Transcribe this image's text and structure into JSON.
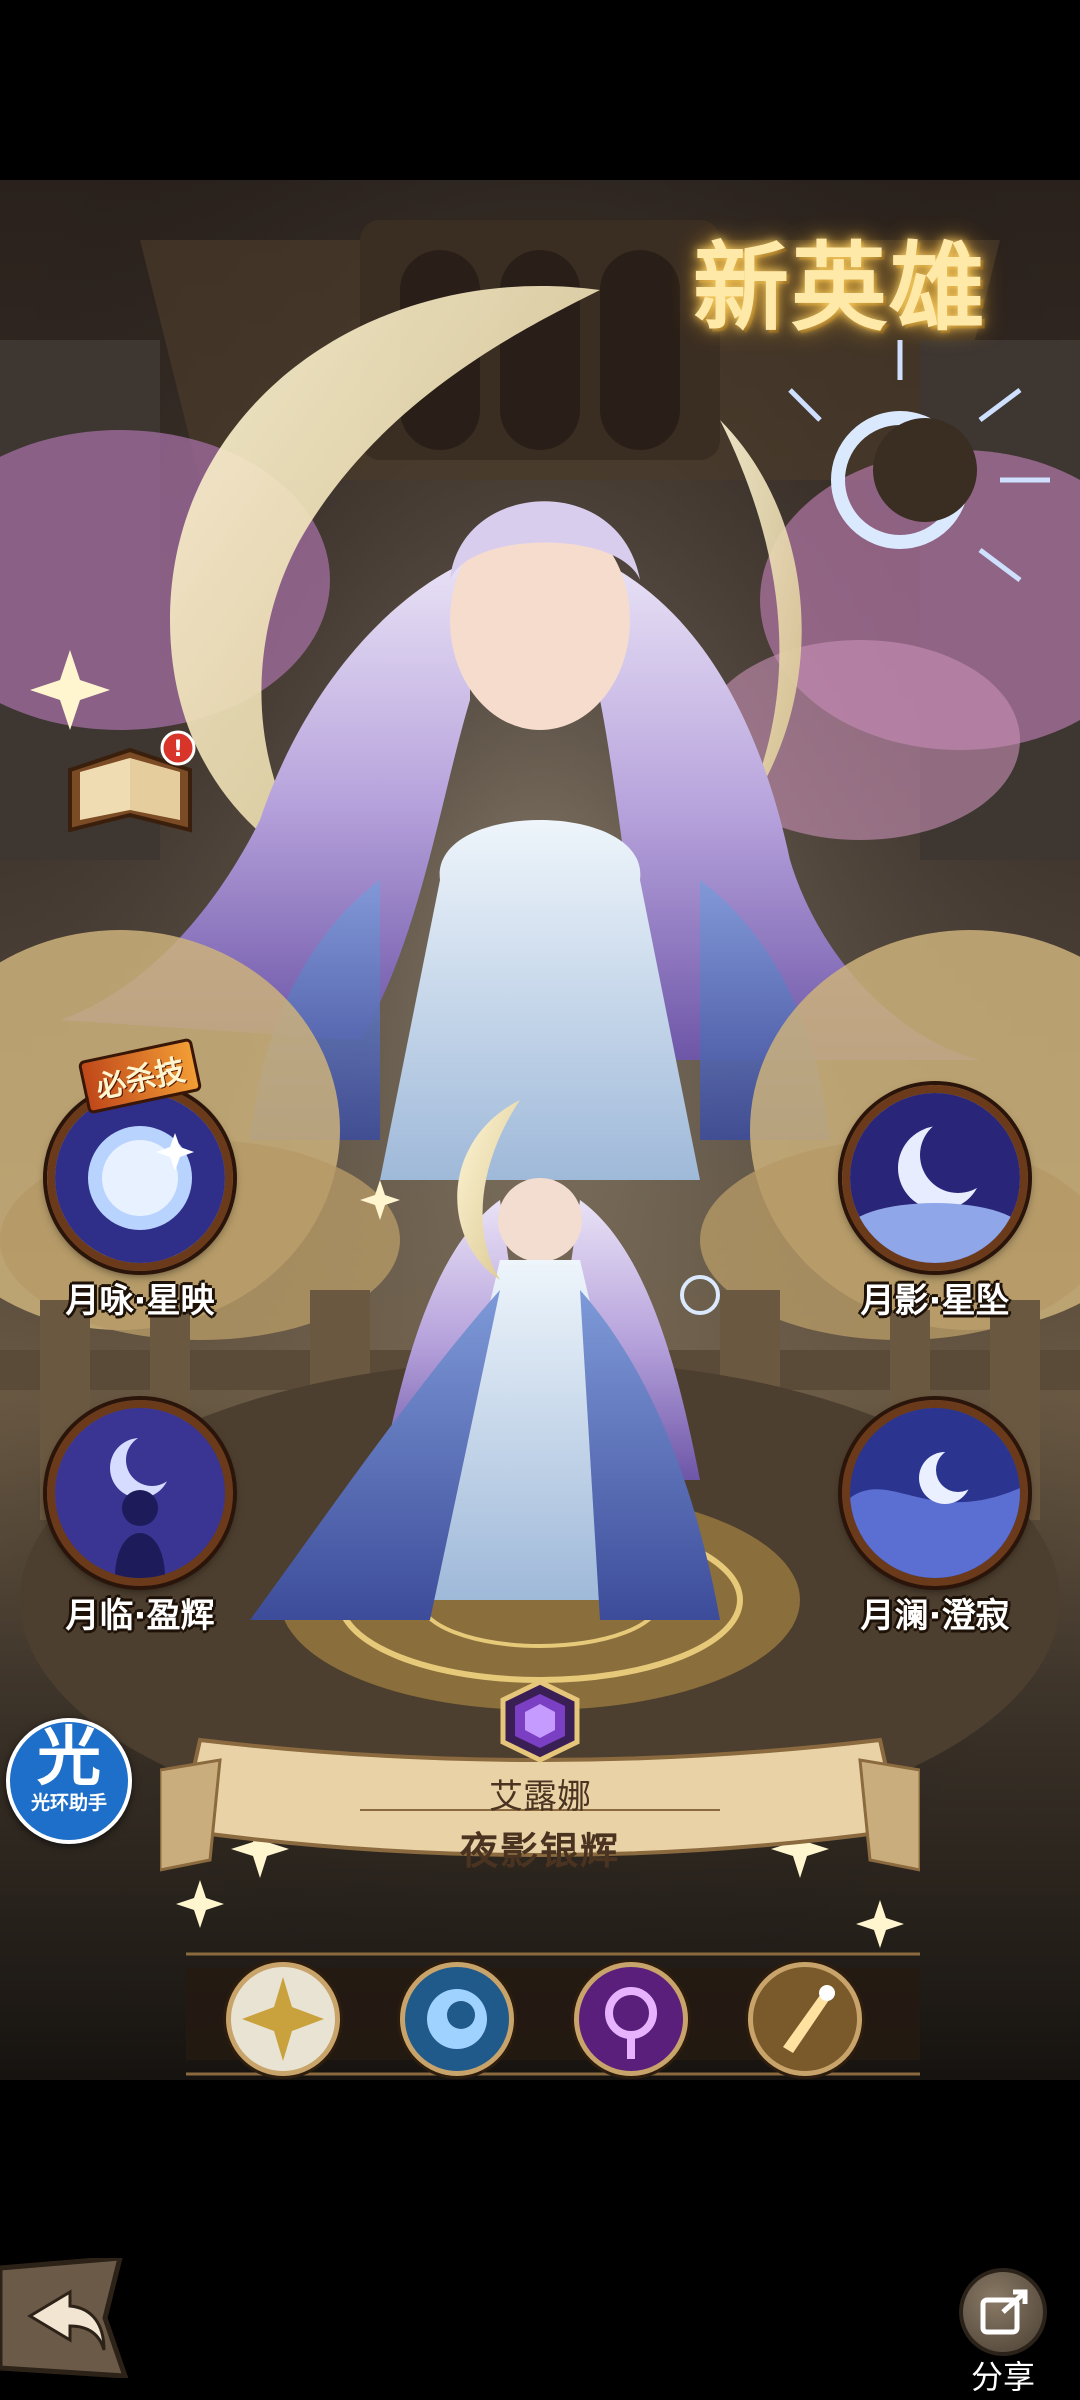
{
  "header": {
    "title": "新英雄"
  },
  "hero": {
    "name": "艾露娜",
    "skin_title": "夜影银辉"
  },
  "ultimate_badge": "必杀技",
  "skills": [
    {
      "id": "ult",
      "label": "月咏·星映"
    },
    {
      "id": "s2",
      "label": "月影·星坠"
    },
    {
      "id": "s3",
      "label": "月临·盈辉"
    },
    {
      "id": "s4",
      "label": "月澜·澄寂"
    }
  ],
  "assistant": {
    "glyph": "光",
    "label": "光环助手"
  },
  "share": {
    "label": "分享"
  },
  "bar_icons": [
    "faction-celestial-icon",
    "intelligence-icon",
    "mage-class-icon",
    "support-role-icon"
  ],
  "colors": {
    "gold": "#ffe9a8",
    "skill_ring": "#6b3a1a",
    "banner": "#e9d3a6",
    "gem": "#7b3fc4"
  }
}
